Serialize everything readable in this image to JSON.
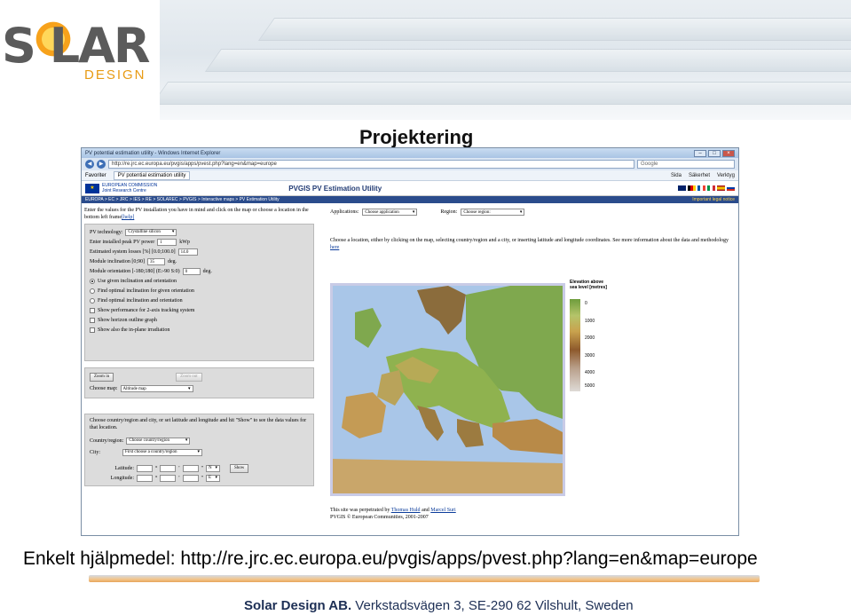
{
  "slide": {
    "title": "Projektering",
    "caption": "Enkelt hjälpmedel: http://re.jrc.ec.europa.eu/pvgis/apps/pvest.php?lang=en&map=europe",
    "footer_company": "Solar Design AB.",
    "footer_address": " Verkstadsvägen 3, SE-290 62 Vilshult, Sweden",
    "logo_word": "S LAR",
    "logo_sub": "DESIGN"
  },
  "browser": {
    "window_title": "PV potential estimation utility - Windows Internet Explorer",
    "url": "http://re.jrc.ec.europa.eu/pvgis/apps/pvest.php?lang=en&map=europe",
    "search_placeholder": "Google",
    "favorites_label": "Favoriter",
    "tab_label": "PV potential estimation utility",
    "cmd_page": "Sida",
    "cmd_safety": "Säkerhet",
    "cmd_tools": "Verktyg"
  },
  "page": {
    "ec_line1": "EUROPEAN COMMISSION",
    "ec_line2": "Joint Research Centre",
    "app_title": "PVGIS  PV Estimation Utility",
    "breadcrumb": "EUROPA > EC > JRC > IES > RE > SOLAREC > PVGIS > Interactive maps > PV Estimation Utility",
    "legal": "Important legal notice",
    "intro": "Enter the values for the PV installation you have in mind and click on the map or choose a location in the bottom left frame",
    "help": "[help]",
    "pv_tech_label": "PV technology:",
    "pv_tech_value": "Crystalline silicon",
    "peak_power_label": "Enter installed peak PV power",
    "peak_power_value": "1",
    "peak_power_unit": "kWp",
    "losses_label": "Estimated system losses [%] [0.0;100.0]",
    "losses_value": "14.0",
    "incl_label": "Module inclination [0;90]",
    "incl_value": "35",
    "incl_unit": "deg.",
    "orient_label": "Module orientation [-180;180] (E:-90 S:0)",
    "orient_value": "0",
    "orient_unit": "deg.",
    "opt_use_given": "Use given inclination and orientation",
    "opt_find_incl": "Find optimal inclination for given orientation",
    "opt_find_both": "Find optimal inclination and orientation",
    "chk_2axis": "Show performance for 2-axis tracking system",
    "chk_horizon": "Show horizon outline graph",
    "chk_inplane": "Show also the in-plane irradiation",
    "zoom_in": "Zoom in",
    "zoom_out": "Zoom out",
    "choose_map_label": "Choose map:",
    "choose_map_value": "Altitude map",
    "loc_intro": "Choose country/region and city, or set latitude and longitude and hit \"Show\" to see the data values for that location.",
    "country_label": "Country/region:",
    "country_value": "Choose country/region",
    "city_label": "City:",
    "city_value": "First choose a country/region",
    "lat_label": "Latitude:",
    "lat_hemi": "N",
    "lon_label": "Longitude:",
    "lon_hemi": "E",
    "deg_sym": "°",
    "min_sym": "'",
    "sec_sym": "\"",
    "show_btn": "Show",
    "applications_label": "Applications:",
    "applications_value": "Choose application",
    "region_label": "Region:",
    "region_value": "Choose region:",
    "choose_text": "Choose a location, either by clicking on the map, selecting country/region and a city, or inserting latitude and longitude coordinates. See more information about the data and methodology",
    "here": "here",
    "legend_title": "Elevation above sea level [metres]",
    "legend_ticks": [
      "0",
      "1000",
      "2000",
      "3000",
      "4000",
      "5000"
    ],
    "credit_prefix": "This site was perpetrated by ",
    "credit_author1": "Thomas Huld",
    "credit_and": " and ",
    "credit_author2": "Marcel Suri",
    "copyright": "PVGIS © European Communities, 2001-2007"
  },
  "colors": {
    "brand_orange": "#f7a21b",
    "ec_blue": "#003399",
    "breadcrumb_bg": "#2b4c8c",
    "footer_text": "#1d2f55"
  }
}
